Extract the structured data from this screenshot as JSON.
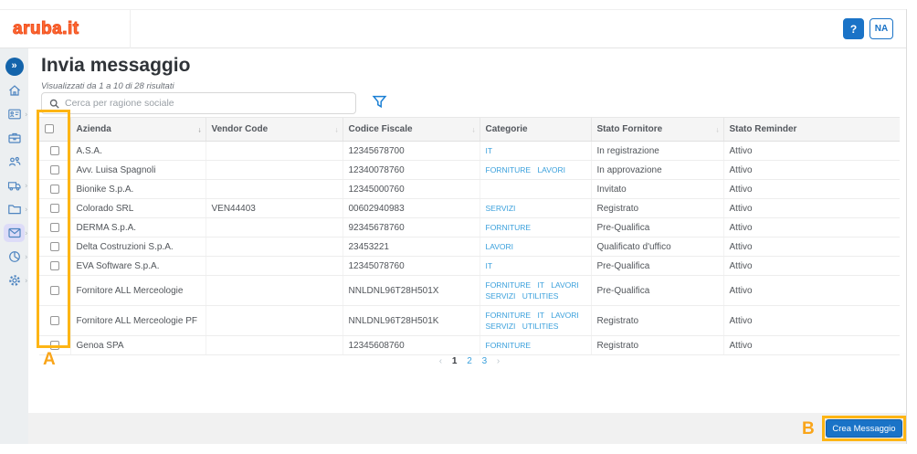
{
  "colors": {
    "accent_blue": "#1a73c7",
    "link_blue": "#3aa0dc",
    "logo_orange": "#ef4f1e",
    "annotation_orange": "#fdb515",
    "sidebar_bg": "#eceff1",
    "active_item_bg": "#dddcf8"
  },
  "header": {
    "logo_text": "aruba.it",
    "help_button": "?",
    "user_badge": "NA"
  },
  "sidebar": {
    "items": [
      "collapse",
      "home",
      "contacts",
      "briefcase",
      "team",
      "truck",
      "folder",
      "mail",
      "pie-chart",
      "gear"
    ],
    "active_item": "mail"
  },
  "page": {
    "title": "Invia messaggio",
    "results_summary": "Visualizzati da 1 a 10 di 28 risultati",
    "search": {
      "placeholder": "Cerca per ragione sociale"
    }
  },
  "table": {
    "columns": {
      "azienda": "Azienda",
      "vendor_code": "Vendor Code",
      "codice_fiscale": "Codice Fiscale",
      "categorie": "Categorie",
      "stato_fornitore": "Stato Fornitore",
      "stato_reminder": "Stato Reminder"
    },
    "rows": [
      {
        "azienda": "A.S.A.",
        "vendor_code": "",
        "codice_fiscale": "12345678700",
        "categorie": "IT",
        "stato_fornitore": "In registrazione",
        "stato_reminder": "Attivo"
      },
      {
        "azienda": "Avv. Luisa Spagnoli",
        "vendor_code": "",
        "codice_fiscale": "12340078760",
        "categorie": "FORNITURE LAVORI",
        "stato_fornitore": "In approvazione",
        "stato_reminder": "Attivo"
      },
      {
        "azienda": "Bionike S.p.A.",
        "vendor_code": "",
        "codice_fiscale": "12345000760",
        "categorie": "",
        "stato_fornitore": "Invitato",
        "stato_reminder": "Attivo"
      },
      {
        "azienda": "Colorado SRL",
        "vendor_code": "VEN44403",
        "codice_fiscale": "00602940983",
        "categorie": "SERVIZI",
        "stato_fornitore": "Registrato",
        "stato_reminder": "Attivo"
      },
      {
        "azienda": "DERMA S.p.A.",
        "vendor_code": "",
        "codice_fiscale": "92345678760",
        "categorie": "FORNITURE",
        "stato_fornitore": "Pre-Qualifica",
        "stato_reminder": "Attivo"
      },
      {
        "azienda": "Delta Costruzioni S.p.A.",
        "vendor_code": "",
        "codice_fiscale": "23453221",
        "categorie": "LAVORI",
        "stato_fornitore": "Qualificato d'uffico",
        "stato_reminder": "Attivo"
      },
      {
        "azienda": "EVA Software S.p.A.",
        "vendor_code": "",
        "codice_fiscale": "12345078760",
        "categorie": "IT",
        "stato_fornitore": "Pre-Qualifica",
        "stato_reminder": "Attivo"
      },
      {
        "azienda": "Fornitore ALL Merceologie",
        "vendor_code": "",
        "codice_fiscale": "NNLDNL96T28H501X",
        "categorie": "FORNITURE IT LAVORI SERVIZI UTILITIES",
        "stato_fornitore": "Pre-Qualifica",
        "stato_reminder": "Attivo"
      },
      {
        "azienda": "Fornitore ALL Merceologie PF",
        "vendor_code": "",
        "codice_fiscale": "NNLDNL96T28H501K",
        "categorie": "FORNITURE IT LAVORI SERVIZI UTILITIES",
        "stato_fornitore": "Registrato",
        "stato_reminder": "Attivo"
      },
      {
        "azienda": "Genoa SPA",
        "vendor_code": "",
        "codice_fiscale": "12345608760",
        "categorie": "FORNITURE",
        "stato_fornitore": "Registrato",
        "stato_reminder": "Attivo"
      }
    ]
  },
  "pagination": {
    "prev": "‹",
    "page1": "1",
    "page2": "2",
    "page3": "3",
    "next": "›",
    "current_page": "1"
  },
  "footer": {
    "create_message_button": "Crea Messaggio"
  },
  "annotations": {
    "label_a": "A",
    "label_b": "B"
  }
}
